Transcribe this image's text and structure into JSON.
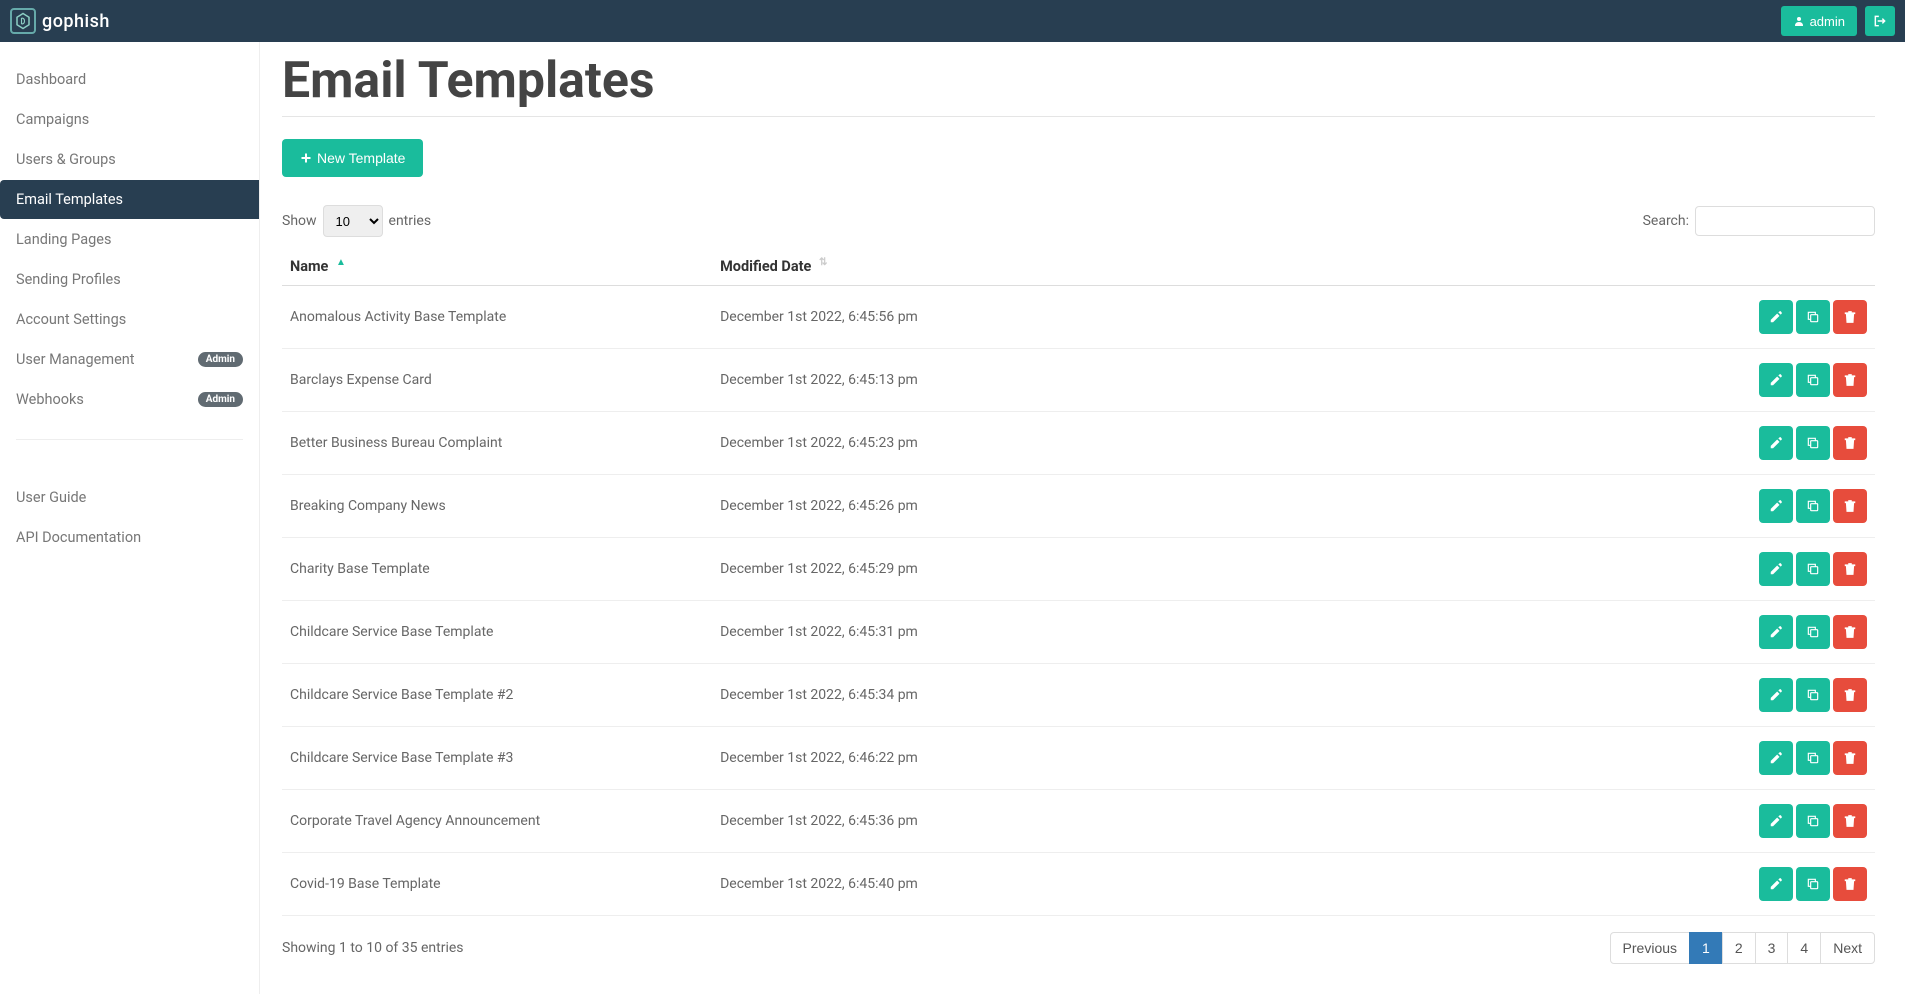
{
  "brand": "gophish",
  "header": {
    "user_label": "admin"
  },
  "sidebar": {
    "items": [
      {
        "label": "Dashboard",
        "active": false,
        "badge": null
      },
      {
        "label": "Campaigns",
        "active": false,
        "badge": null
      },
      {
        "label": "Users & Groups",
        "active": false,
        "badge": null
      },
      {
        "label": "Email Templates",
        "active": true,
        "badge": null
      },
      {
        "label": "Landing Pages",
        "active": false,
        "badge": null
      },
      {
        "label": "Sending Profiles",
        "active": false,
        "badge": null
      },
      {
        "label": "Account Settings",
        "active": false,
        "badge": null
      },
      {
        "label": "User Management",
        "active": false,
        "badge": "Admin"
      },
      {
        "label": "Webhooks",
        "active": false,
        "badge": "Admin"
      }
    ],
    "footer_items": [
      {
        "label": "User Guide"
      },
      {
        "label": "API Documentation"
      }
    ]
  },
  "main": {
    "title": "Email Templates",
    "new_button": "New Template",
    "show_label_prefix": "Show",
    "show_label_suffix": "entries",
    "page_size": "10",
    "search_label": "Search:",
    "search_value": "",
    "columns": {
      "name": "Name",
      "modified": "Modified Date"
    },
    "rows": [
      {
        "name": "Anomalous Activity Base Template",
        "modified": "December 1st 2022, 6:45:56 pm"
      },
      {
        "name": "Barclays Expense Card",
        "modified": "December 1st 2022, 6:45:13 pm"
      },
      {
        "name": "Better Business Bureau Complaint",
        "modified": "December 1st 2022, 6:45:23 pm"
      },
      {
        "name": "Breaking Company News",
        "modified": "December 1st 2022, 6:45:26 pm"
      },
      {
        "name": "Charity Base Template",
        "modified": "December 1st 2022, 6:45:29 pm"
      },
      {
        "name": "Childcare Service Base Template",
        "modified": "December 1st 2022, 6:45:31 pm"
      },
      {
        "name": "Childcare Service Base Template #2",
        "modified": "December 1st 2022, 6:45:34 pm"
      },
      {
        "name": "Childcare Service Base Template #3",
        "modified": "December 1st 2022, 6:46:22 pm"
      },
      {
        "name": "Corporate Travel Agency Announcement",
        "modified": "December 1st 2022, 6:45:36 pm"
      },
      {
        "name": "Covid-19 Base Template",
        "modified": "December 1st 2022, 6:45:40 pm"
      }
    ],
    "info_text": "Showing 1 to 10 of 35 entries",
    "pagination": {
      "prev": "Previous",
      "next": "Next",
      "pages": [
        "1",
        "2",
        "3",
        "4"
      ],
      "active_page": "1"
    }
  }
}
